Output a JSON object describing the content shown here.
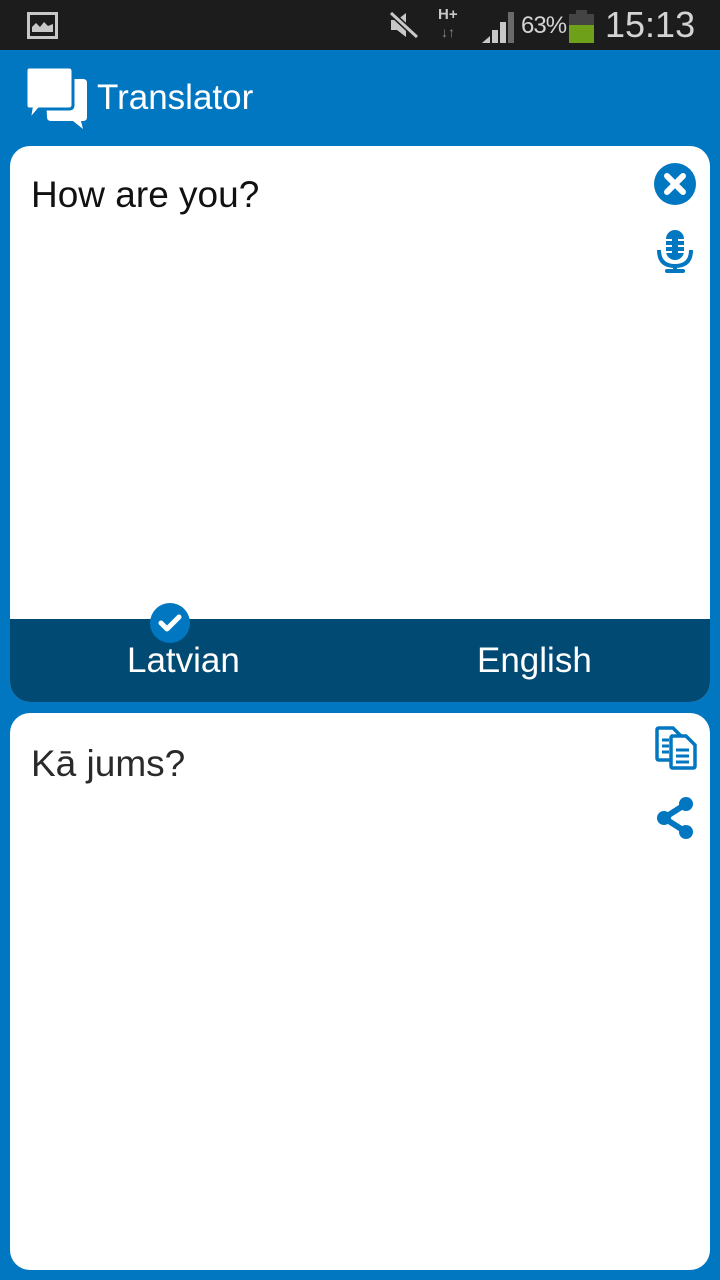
{
  "status_bar": {
    "icons": [
      "gallery-icon",
      "mute-icon",
      "hplus-data-icon",
      "signal-icon",
      "battery-icon"
    ],
    "network": "H+",
    "battery_percent": "63%",
    "battery_level": 0.63,
    "time": "15:13"
  },
  "app_bar": {
    "logo_icon": "chat-bubbles-icon",
    "title": "Translator"
  },
  "source": {
    "text": "How are you?",
    "clear_icon": "close-circle-icon",
    "mic_icon": "microphone-icon"
  },
  "languages": {
    "source_language": "Latvian",
    "target_language": "English",
    "selected": "Latvian",
    "selected_icon": "check-icon"
  },
  "target": {
    "text": "Kā jums?",
    "copy_icon": "copy-icon",
    "share_icon": "share-icon"
  },
  "colors": {
    "primary": "#0277c1",
    "language_bar": "#004a74",
    "battery": "#6fa01a",
    "status_bar": "#1c1c1c"
  }
}
